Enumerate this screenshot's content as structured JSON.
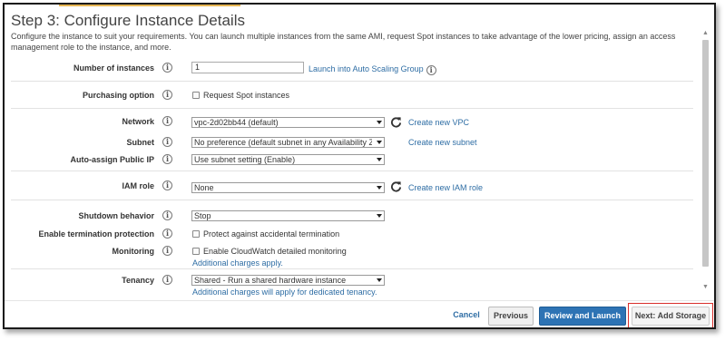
{
  "page": {
    "title": "Step 3: Configure Instance Details",
    "description": "Configure the instance to suit your requirements. You can launch multiple instances from the same AMI, request Spot instances to take advantage of the lower pricing, assign an access management role to the instance, and more."
  },
  "info_glyph": "i",
  "fields": {
    "num_instances": {
      "label": "Number of instances",
      "value": "1",
      "link": "Launch into Auto Scaling Group"
    },
    "purchasing": {
      "label": "Purchasing option",
      "checkbox": "Request Spot instances"
    },
    "network": {
      "label": "Network",
      "value": "vpc-2d02bb44 (default)",
      "link": "Create new VPC"
    },
    "subnet": {
      "label": "Subnet",
      "value": "No preference (default subnet in any Availability Zone)",
      "link": "Create new subnet"
    },
    "public_ip": {
      "label": "Auto-assign Public IP",
      "value": "Use subnet setting (Enable)"
    },
    "iam_role": {
      "label": "IAM role",
      "value": "None",
      "link": "Create new IAM role"
    },
    "shutdown": {
      "label": "Shutdown behavior",
      "value": "Stop"
    },
    "termination": {
      "label": "Enable termination protection",
      "checkbox": "Protect against accidental termination"
    },
    "monitoring": {
      "label": "Monitoring",
      "checkbox": "Enable CloudWatch detailed monitoring",
      "note": "Additional charges apply."
    },
    "tenancy": {
      "label": "Tenancy",
      "value": "Shared - Run a shared hardware instance",
      "note": "Additional charges will apply for dedicated tenancy."
    }
  },
  "buttons": {
    "cancel": "Cancel",
    "previous": "Previous",
    "review": "Review and Launch",
    "next": "Next: Add Storage"
  },
  "colors": {
    "link": "#2e6da4",
    "primary_button": "#2d73b4",
    "highlight": "#d9302c"
  }
}
